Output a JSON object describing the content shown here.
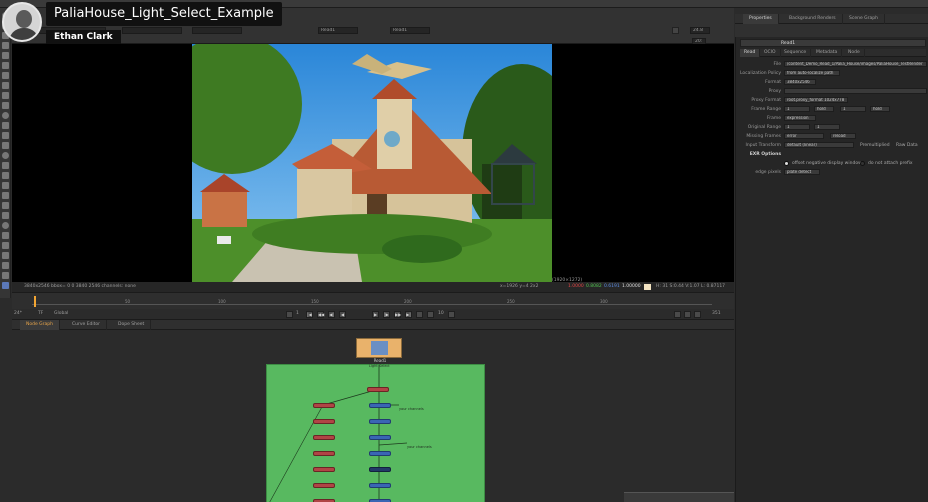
{
  "overlay": {
    "video_title": "PaliaHouse_Light_Select_Example",
    "author": "Ethan Clark"
  },
  "viewer": {
    "input_a": "Read1",
    "input_b": "Read1",
    "fps": "24.8",
    "zoom": "20:",
    "info_left": "3840x2546 bbox= 0 0 3840 2546 channels: none",
    "info_mid": "x=1926 y=4 2x2",
    "info_coords": "(1920×1272)",
    "pixel_values": [
      "1.0000",
      "0.8082",
      "0.6191",
      "1.00000"
    ],
    "info_right": "H: 31 S:0.44 V:1.07  L: 0.87117"
  },
  "timeline": {
    "labels": [
      "50",
      "100",
      "150",
      "200",
      "250",
      "300"
    ],
    "fps_select": "24*",
    "tf_select": "TF",
    "global_select": "Global",
    "frame_current": "1",
    "frame_step": "10",
    "frame_end": "351"
  },
  "node_graph": {
    "tabs": [
      "Node Graph",
      "Curve Editor",
      "Dope Sheet"
    ],
    "read_node_label": "Read1",
    "notes": [
      "Light Select",
      "your channels",
      "your channels"
    ]
  },
  "props": {
    "tabs": [
      "Properties",
      "Background Renders",
      "Scene Graph"
    ],
    "node_name": "Read1",
    "subtabs": [
      "Read",
      "OCIO",
      "Sequence",
      "Metadata",
      "Node"
    ],
    "rows": [
      {
        "label": "File",
        "value": "/content_Demo_Read_1/Palia_House/images/PaliaHouse_TestRender"
      },
      {
        "label": "Localization Policy",
        "value": "from auto-localize path"
      },
      {
        "label": "Format",
        "value": "3840x2546"
      },
      {
        "label": "Proxy",
        "value": ""
      },
      {
        "label": "Proxy Format",
        "value": "root.proxy_format 1024x778"
      },
      {
        "label": "Frame Range",
        "value": "1",
        "extra": [
          "hold",
          "1",
          "hold"
        ]
      },
      {
        "label": "Frame",
        "value": "expression"
      },
      {
        "label": "Original Range",
        "value": "1",
        "extra": [
          "1"
        ]
      },
      {
        "label": "Missing Frames",
        "value": "error",
        "extra": [
          "reload"
        ]
      },
      {
        "label": "Input Transform",
        "value": "default (linear)",
        "extra": [
          "Premultiplied",
          "Raw Data"
        ]
      },
      {
        "label": "EXR Options",
        "value": ""
      },
      {
        "label": "",
        "value": "",
        "extra": [
          "offset negative display window",
          "do not attach prefix"
        ]
      },
      {
        "label": "edge pixels",
        "value": "plate detect"
      }
    ]
  }
}
